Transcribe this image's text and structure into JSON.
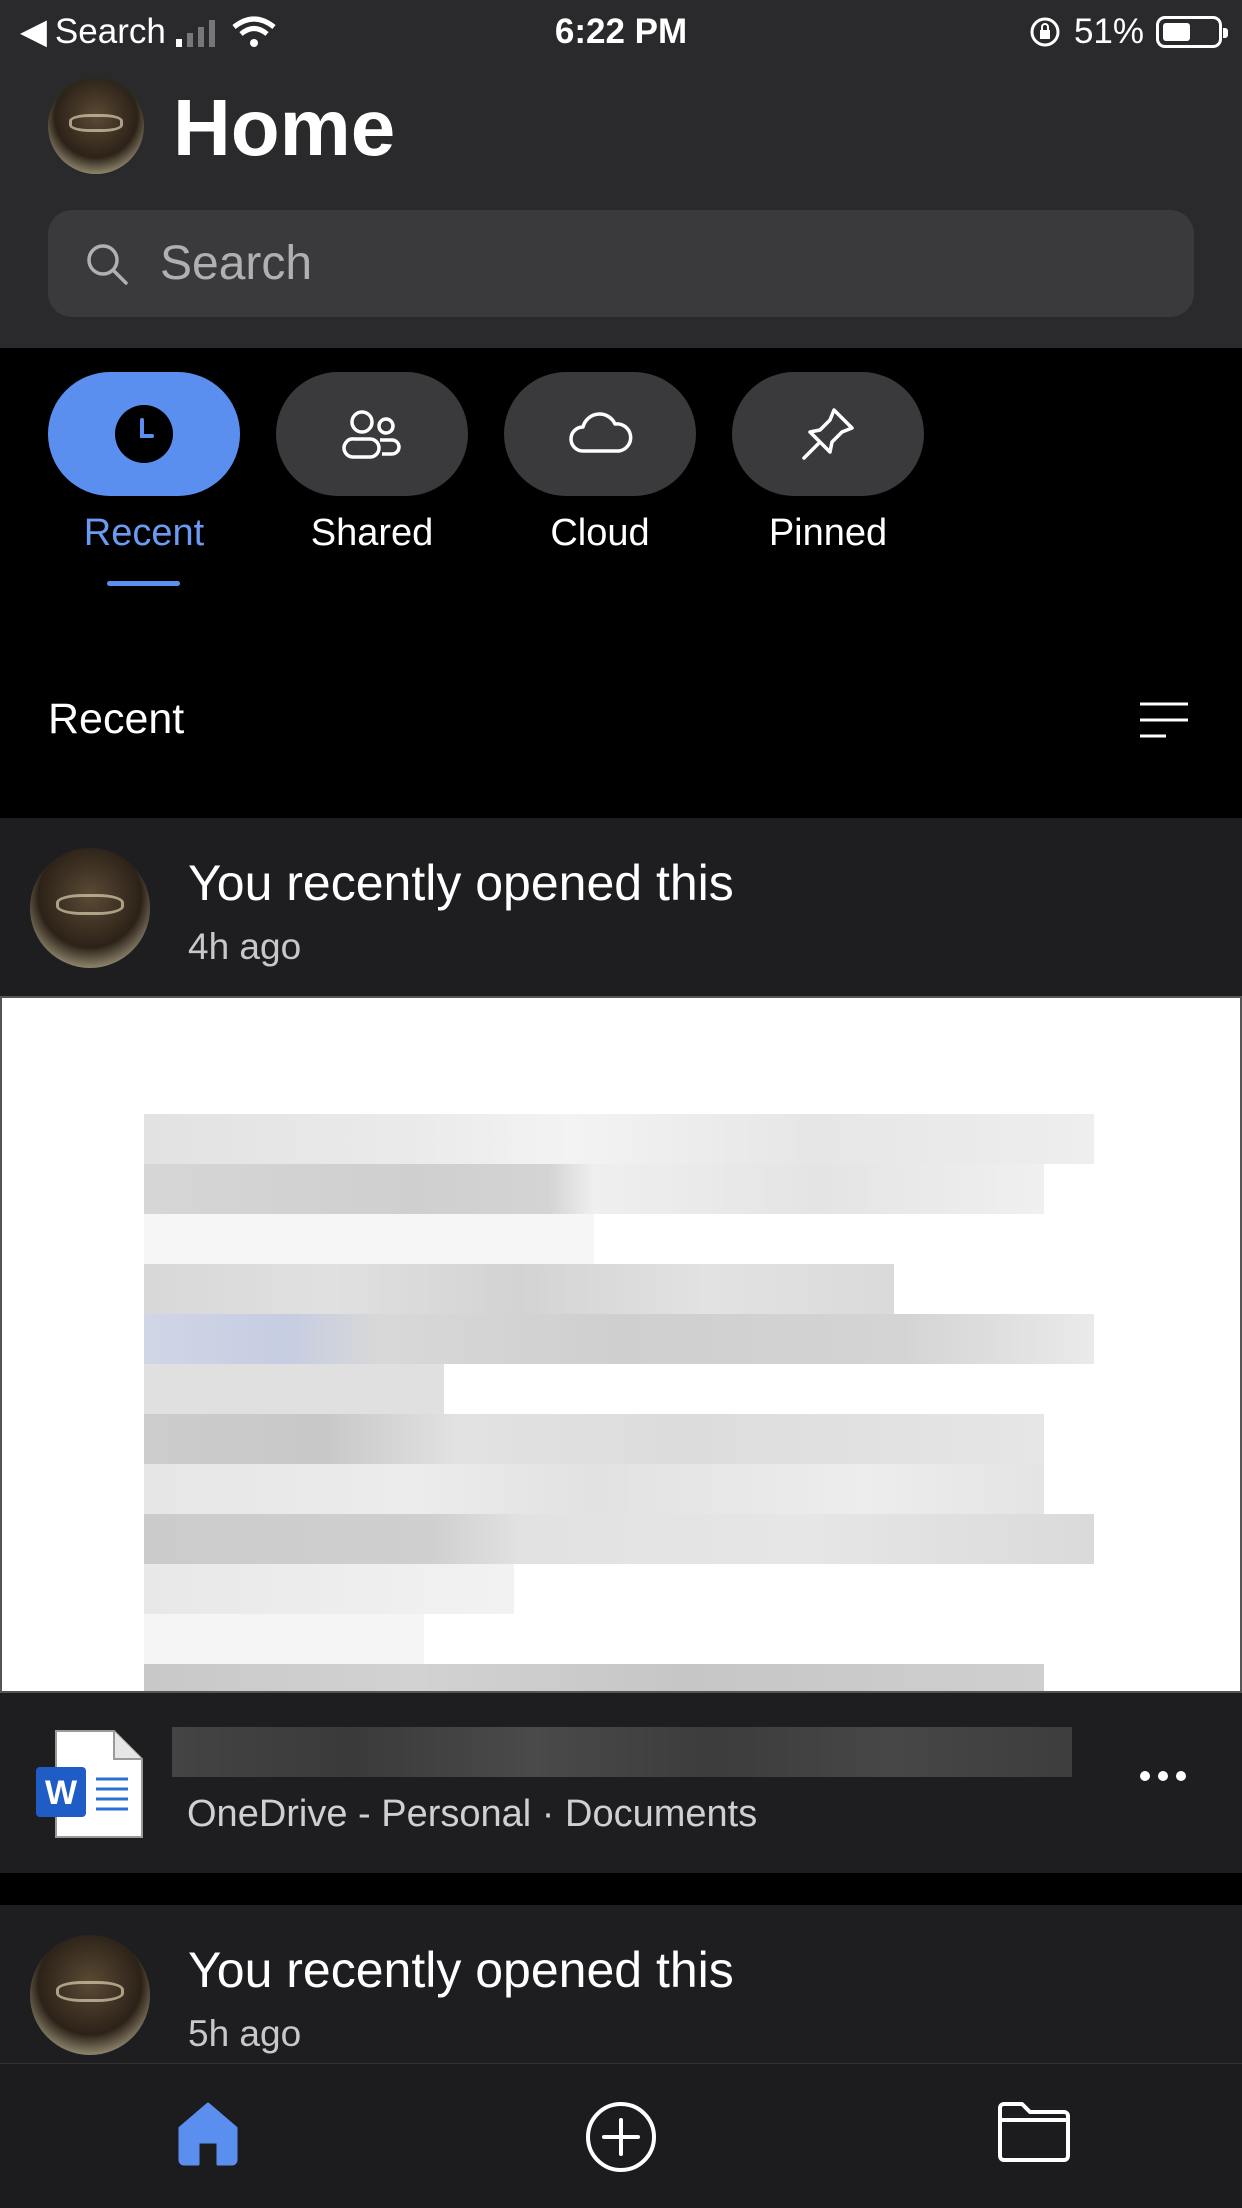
{
  "status": {
    "back_label": "Search",
    "time": "6:22 PM",
    "battery": "51%",
    "battery_level": 0.51
  },
  "header": {
    "title": "Home"
  },
  "search": {
    "placeholder": "Search"
  },
  "filters": [
    {
      "label": "Recent",
      "icon": "clock-icon",
      "active": true
    },
    {
      "label": "Shared",
      "icon": "people-icon",
      "active": false
    },
    {
      "label": "Cloud",
      "icon": "cloud-icon",
      "active": false
    },
    {
      "label": "Pinned",
      "icon": "pin-icon",
      "active": false
    }
  ],
  "section": {
    "title": "Recent"
  },
  "activities": [
    {
      "message": "You recently opened this",
      "when": "4h ago",
      "file": {
        "icon": "word-document-icon",
        "location": "OneDrive - Personal · Documents"
      }
    },
    {
      "message": "You recently opened this",
      "when": "5h ago"
    }
  ],
  "tabbar": [
    {
      "icon": "home-icon",
      "active": true
    },
    {
      "icon": "add-circle-icon",
      "active": false
    },
    {
      "icon": "folder-icon",
      "active": false
    }
  ],
  "colors": {
    "accent": "#5a8ff0",
    "header_bg": "#2a2a2c",
    "card_bg": "#1e1e20"
  }
}
